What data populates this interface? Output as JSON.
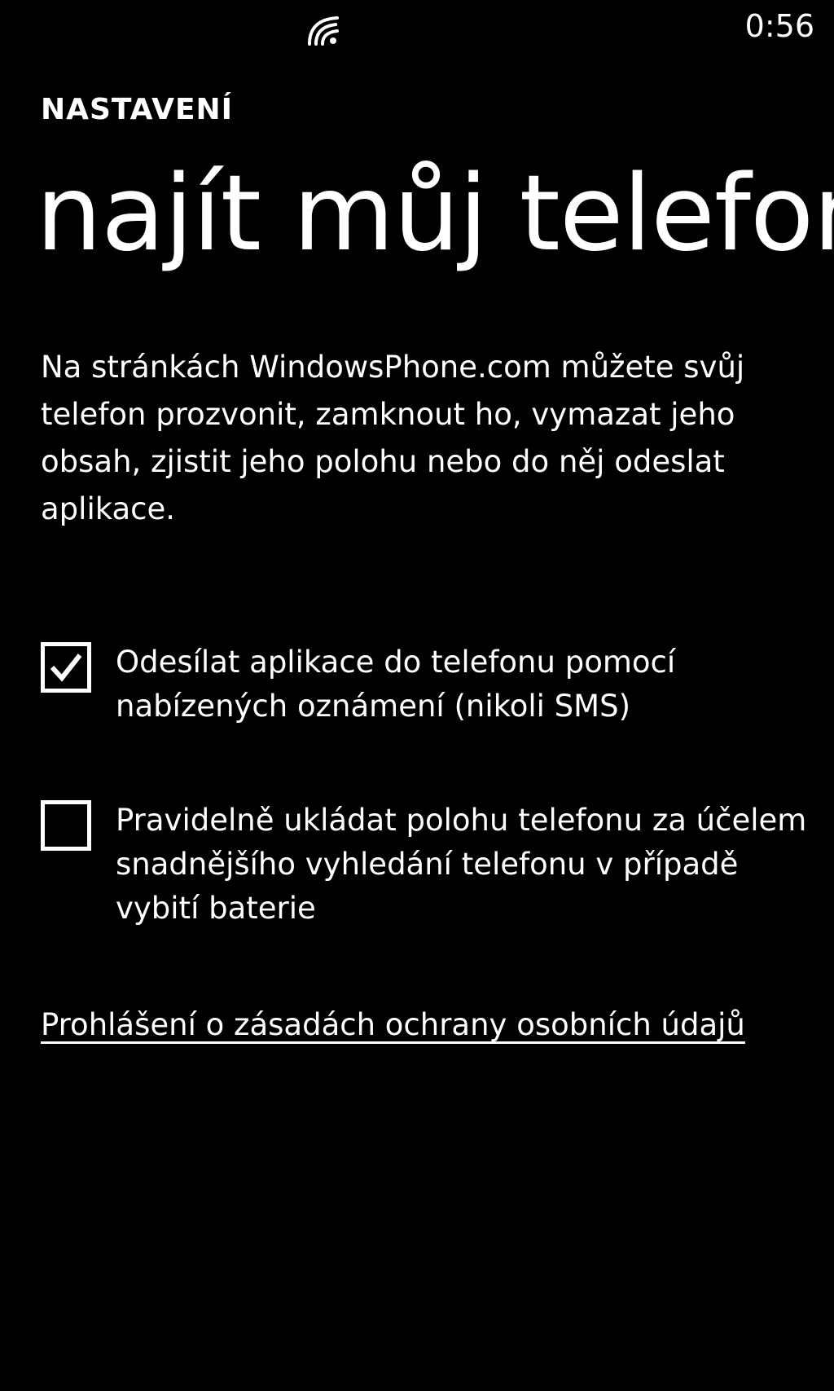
{
  "status_bar": {
    "wifi_icon": "wifi-icon",
    "time": "0:56"
  },
  "header": {
    "app_title": "NASTAVENÍ",
    "page_title": "najít můj telefon"
  },
  "description": "Na stránkách WindowsPhone.com můžete svůj telefon prozvonit, zamknout ho, vymazat jeho obsah, zjistit jeho polohu nebo do něj odeslat aplikace.",
  "options": [
    {
      "label": "Odesílat aplikace do telefonu pomocí nabízených oznámení (nikoli SMS)",
      "checked": true
    },
    {
      "label": "Pravidelně ukládat polohu telefonu za účelem snadnějšího vyhledání telefonu v případě vybití baterie",
      "checked": false
    }
  ],
  "privacy_link": "Prohlášení o zásadách ochrany osobních údajů",
  "colors": {
    "background": "#000000",
    "foreground": "#ffffff"
  }
}
